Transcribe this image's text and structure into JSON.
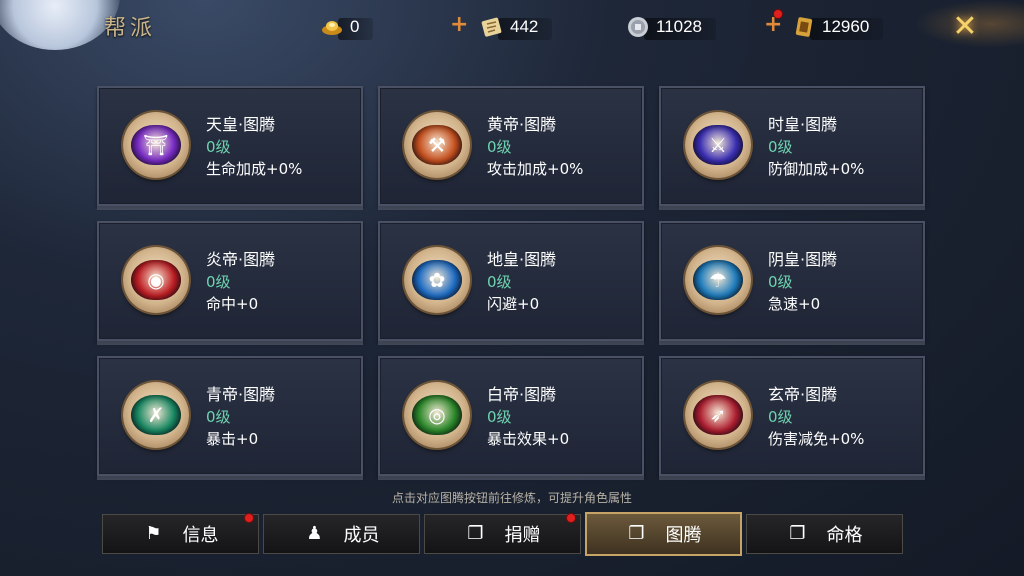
{
  "header": {
    "title": "帮派"
  },
  "resources": {
    "gold": {
      "icon": "gold-ingot-icon",
      "value": "0"
    },
    "scroll": {
      "icon": "scroll-icon",
      "value": "442"
    },
    "coin": {
      "icon": "silver-coin-icon",
      "value": "11028"
    },
    "token": {
      "icon": "gold-token-icon",
      "value": "12960"
    }
  },
  "plus_label": "+",
  "close_label": "✕",
  "cards": [
    {
      "name": "天皇·图腾",
      "level": "0级",
      "attr": "生命加成+0%",
      "color": "#7a2bc8",
      "glyph": "⛩"
    },
    {
      "name": "黄帝·图腾",
      "level": "0级",
      "attr": "攻击加成+0%",
      "color": "#c8501e",
      "glyph": "⚒"
    },
    {
      "name": "时皇·图腾",
      "level": "0级",
      "attr": "防御加成+0%",
      "color": "#3b2fb8",
      "glyph": "⚔"
    },
    {
      "name": "炎帝·图腾",
      "level": "0级",
      "attr": "命中+0",
      "color": "#c01e24",
      "glyph": "◉"
    },
    {
      "name": "地皇·图腾",
      "level": "0级",
      "attr": "闪避+0",
      "color": "#1e6ec8",
      "glyph": "✿"
    },
    {
      "name": "阴皇·图腾",
      "level": "0级",
      "attr": "急速+0",
      "color": "#1e7ec0",
      "glyph": "☂"
    },
    {
      "name": "青帝·图腾",
      "level": "0级",
      "attr": "暴击+0",
      "color": "#178a64",
      "glyph": "✗"
    },
    {
      "name": "白帝·图腾",
      "level": "0级",
      "attr": "暴击效果+0",
      "color": "#2a8a2a",
      "glyph": "◎"
    },
    {
      "name": "玄帝·图腾",
      "level": "0级",
      "attr": "伤害减免+0%",
      "color": "#b01e30",
      "glyph": "➶"
    }
  ],
  "hint": "点击对应图腾按钮前往修炼，可提升角色属性",
  "tabs": [
    {
      "label": "信息",
      "icon": "flag-icon",
      "glyph": "⚑",
      "active": false,
      "dot": true
    },
    {
      "label": "成员",
      "icon": "member-icon",
      "glyph": "♟",
      "active": false,
      "dot": false
    },
    {
      "label": "捐赠",
      "icon": "book-icon",
      "glyph": "❐",
      "active": false,
      "dot": true
    },
    {
      "label": "图腾",
      "icon": "book-icon",
      "glyph": "❐",
      "active": true,
      "dot": false
    },
    {
      "label": "命格",
      "icon": "book-icon",
      "glyph": "❐",
      "active": false,
      "dot": false
    }
  ]
}
